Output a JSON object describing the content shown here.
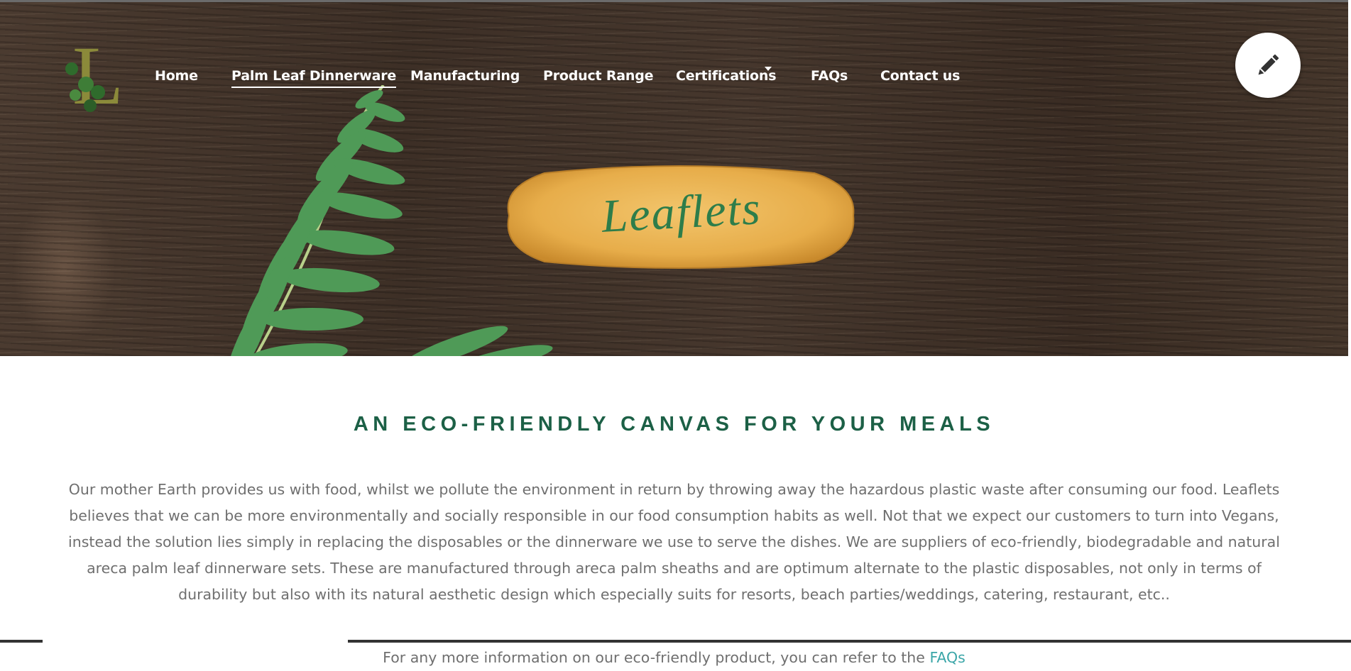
{
  "header": {
    "logo_letter": "L",
    "nav": [
      {
        "label": "Home",
        "active": false
      },
      {
        "label": "Palm Leaf Dinnerware",
        "active": true
      },
      {
        "label": "Manufacturing",
        "active": false
      },
      {
        "label": "Product Range",
        "active": false
      },
      {
        "label": "Certifications",
        "active": false,
        "has_dropdown": true
      },
      {
        "label": "FAQs",
        "active": false
      },
      {
        "label": "Contact us",
        "active": false
      }
    ],
    "edit_icon": "pencil-icon"
  },
  "hero": {
    "plate_text": "Leaflets"
  },
  "main": {
    "heading": "AN ECO-FRIENDLY CANVAS FOR YOUR MEALS",
    "paragraph": "Our mother Earth provides us with food, whilst we pollute the environment in return by throwing away the hazardous plastic waste after consuming our food. Leaflets believes that we can be more environmentally and socially responsible in our food consumption habits as well. Not that we expect our customers to turn into Vegans, instead the solution lies simply in replacing the disposables or the dinnerware we use to serve the dishes. We are suppliers of eco-friendly, biodegradable and natural areca palm leaf dinnerware sets. These are manufactured through areca palm sheaths and are optimum alternate to the plastic disposables, not only in terms of durability but also with its natural aesthetic design which especially suits for resorts, beach parties/weddings, catering, restaurant, etc..",
    "more_info_prefix": "For any more information on our eco-friendly product, you can refer to the",
    "more_info_link": "FAQs"
  },
  "colors": {
    "heading": "#1c6046",
    "body_text": "#6f6f6f",
    "link": "#3ba6a8",
    "nav_text": "#ffffff"
  }
}
